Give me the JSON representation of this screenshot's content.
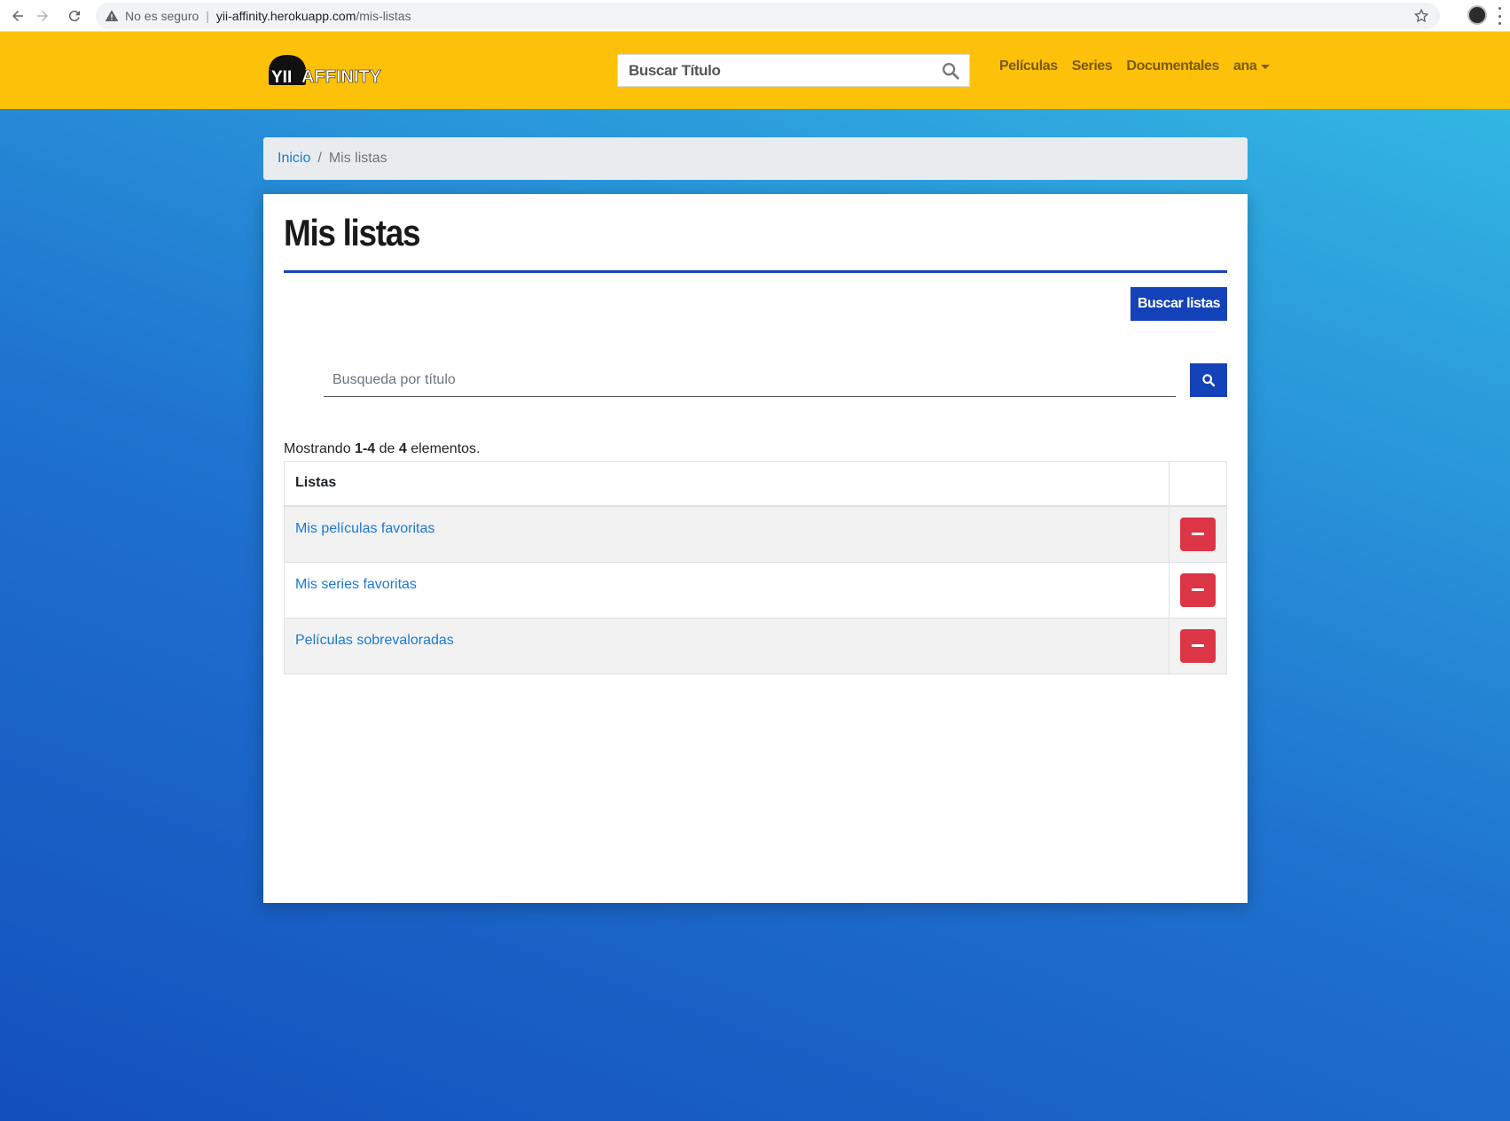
{
  "browser": {
    "security_label": "No es seguro",
    "url_host": "yii-affinity.herokuapp.com",
    "url_path": "/mis-listas"
  },
  "navbar": {
    "logo_text": "YIIAFFINITY",
    "search_placeholder": "Buscar Título",
    "links": [
      "Películas",
      "Series",
      "Documentales"
    ],
    "user_menu": "ana"
  },
  "breadcrumb": {
    "home": "Inicio",
    "separator": "/",
    "current": "Mis listas"
  },
  "page": {
    "title": "Mis listas",
    "search_lists_button": "Buscar listas",
    "filter_placeholder": "Busqueda por título",
    "summary": {
      "prefix": "Mostrando ",
      "range": "1-4",
      "middle": " de ",
      "total": "4",
      "suffix": " elementos."
    }
  },
  "table": {
    "header": "Listas",
    "rows": [
      {
        "name": "Mis películas favoritas"
      },
      {
        "name": "Mis series favoritas"
      },
      {
        "name": "Películas sobrevaloradas"
      }
    ]
  },
  "colors": {
    "navbar": "#fdc10a",
    "primary": "#1442b8",
    "danger": "#dc3545",
    "link": "#1b79d4"
  }
}
